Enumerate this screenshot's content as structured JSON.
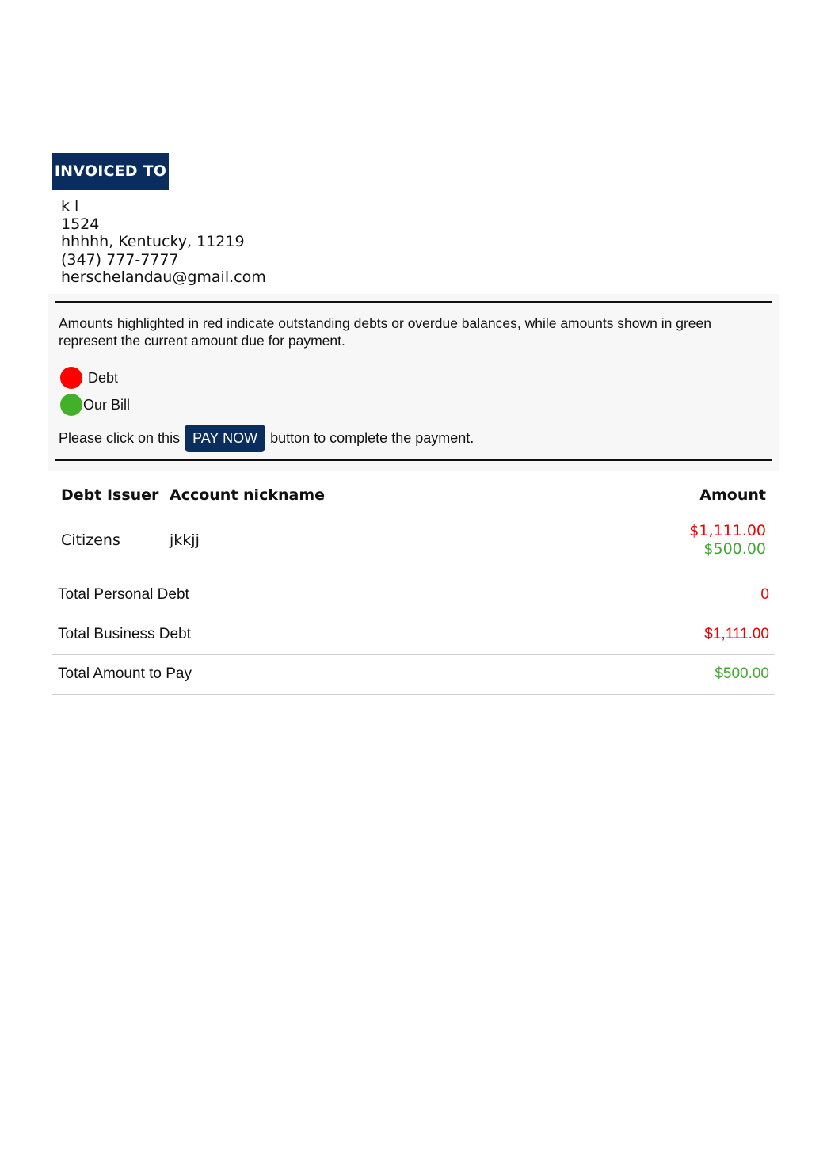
{
  "invoiced_to": {
    "heading": "INVOICED TO",
    "name": "k l",
    "line1": "1524",
    "city_line": "hhhhh, Kentucky, 11219",
    "phone": "(347) 777-7777",
    "email": "herschelandau@gmail.com"
  },
  "notice": {
    "description": "Amounts highlighted in red indicate outstanding debts or overdue balances, while amounts shown in green represent the current amount due for payment.",
    "legend": {
      "debt_label": "Debt",
      "bill_label": "Our Bill",
      "debt_color": "#ff0000",
      "bill_color": "#43b02a"
    },
    "pay_prefix": "Please click on this",
    "pay_button": "PAY NOW",
    "pay_suffix": "button to complete the payment."
  },
  "table": {
    "headers": {
      "issuer": "Debt Issuer",
      "nickname": "Account nickname",
      "amount": "Amount"
    },
    "rows": [
      {
        "issuer": "Citizens",
        "nickname": "jkkjj",
        "debt_amount": "$1,111.00",
        "bill_amount": "$500.00"
      }
    ]
  },
  "totals": {
    "personal_label": "Total Personal Debt",
    "personal_value": "0",
    "business_label": "Total Business Debt",
    "business_value": "$1,111.00",
    "pay_label": "Total Amount to Pay",
    "pay_value": "$500.00"
  },
  "colors": {
    "brand_navy": "#0a2d5e",
    "debt_red": "#ee0000",
    "bill_green": "#43a832"
  }
}
